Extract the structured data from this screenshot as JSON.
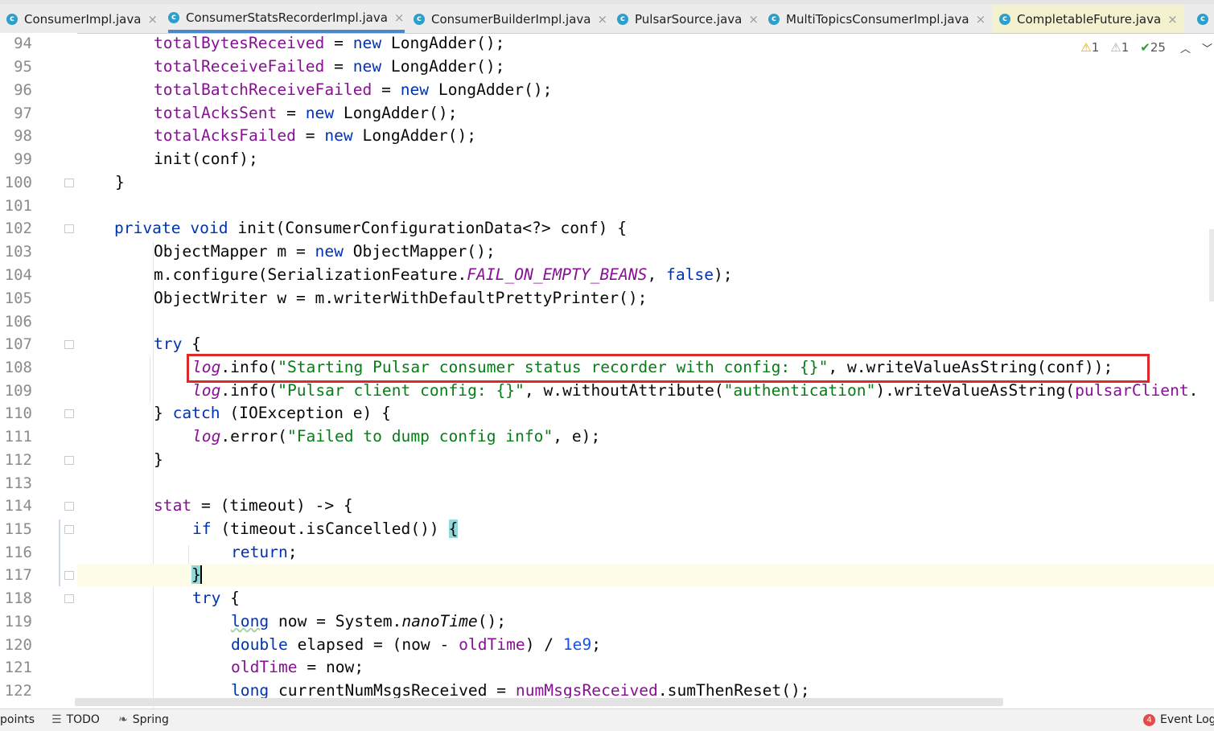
{
  "tabs": [
    {
      "label": "ConsumerImpl.java",
      "close": "×"
    },
    {
      "label": "ConsumerStatsRecorderImpl.java",
      "close": "×"
    },
    {
      "label": "ConsumerBuilderImpl.java",
      "close": "×"
    },
    {
      "label": "PulsarSource.java",
      "close": "×"
    },
    {
      "label": "MultiTopicsConsumerImpl.java",
      "close": "×"
    },
    {
      "label": "CompletableFuture.java",
      "close": "×"
    }
  ],
  "active_tab": "ConsumerStatsRecorderImpl.java",
  "inspections": {
    "warnings": "1",
    "weak_warnings": "1",
    "ok": "25"
  },
  "line_numbers": [
    "94",
    "95",
    "96",
    "97",
    "98",
    "99",
    "100",
    "101",
    "102",
    "103",
    "104",
    "105",
    "106",
    "107",
    "108",
    "109",
    "110",
    "111",
    "112",
    "113",
    "114",
    "115",
    "116",
    "117",
    "118",
    "119",
    "120",
    "121",
    "122"
  ],
  "code": {
    "l94": [
      "totalBytesReceived",
      " = ",
      "new",
      " LongAdder();"
    ],
    "l95": [
      "totalReceiveFailed",
      " = ",
      "new",
      " LongAdder();"
    ],
    "l96": [
      "totalBatchReceiveFailed",
      " = ",
      "new",
      " LongAdder();"
    ],
    "l97": [
      "totalAcksSent",
      " = ",
      "new",
      " LongAdder();"
    ],
    "l98": [
      "totalAcksFailed",
      " = ",
      "new",
      " LongAdder();"
    ],
    "l99": [
      "init(conf);"
    ],
    "l100": [
      "}"
    ],
    "l102": [
      "private void",
      " init(ConsumerConfigurationData<?> conf) {"
    ],
    "l103": [
      "ObjectMapper m = ",
      "new",
      " ObjectMapper();"
    ],
    "l104": [
      "m.configure(SerializationFeature.",
      "FAIL_ON_EMPTY_BEANS",
      ", ",
      "false",
      ");"
    ],
    "l105": [
      "ObjectWriter w = m.writerWithDefaultPrettyPrinter();"
    ],
    "l107": [
      "try",
      " {"
    ],
    "l108": [
      "log",
      ".info(",
      "\"Starting Pulsar consumer status recorder with config: {}\"",
      ", w.writeValueAsString(conf));"
    ],
    "l109": [
      "log",
      ".info(",
      "\"Pulsar client config: {}\"",
      ", w.withoutAttribute(",
      "\"authentication\"",
      ").writeValueAsString(",
      "pulsarClient",
      "."
    ],
    "l110": [
      "} ",
      "catch",
      " (IOException e) {"
    ],
    "l111": [
      "log",
      ".error(",
      "\"Failed to dump config info\"",
      ", e);"
    ],
    "l112": [
      "}"
    ],
    "l114": [
      "stat",
      " = (timeout) -> {"
    ],
    "l115": [
      "if",
      " (timeout.isCancelled()) ",
      "{"
    ],
    "l116": [
      "return",
      ";"
    ],
    "l117": [
      "}"
    ],
    "l118": [
      "try",
      " {"
    ],
    "l119": [
      "long",
      " now = System.",
      "nanoTime",
      "();"
    ],
    "l120": [
      "double",
      " elapsed = (now - ",
      "oldTime",
      ") / ",
      "1e9",
      ";"
    ],
    "l121": [
      "oldTime",
      " = now;"
    ],
    "l122": [
      "long",
      " currentNumMsgsReceived = ",
      "numMsgsReceived",
      ".sumThenReset();"
    ]
  },
  "status_bar": {
    "left": "points",
    "todo": "TODO",
    "spring": "Spring",
    "event_count": "4",
    "event_log": "Event Log"
  },
  "colors": {
    "keyword": "#0033b3",
    "field": "#871094",
    "string": "#067d17",
    "number": "#1750eb",
    "highlight_box": "#dc2a2a",
    "active_tab_underline": "#4a88c7"
  }
}
